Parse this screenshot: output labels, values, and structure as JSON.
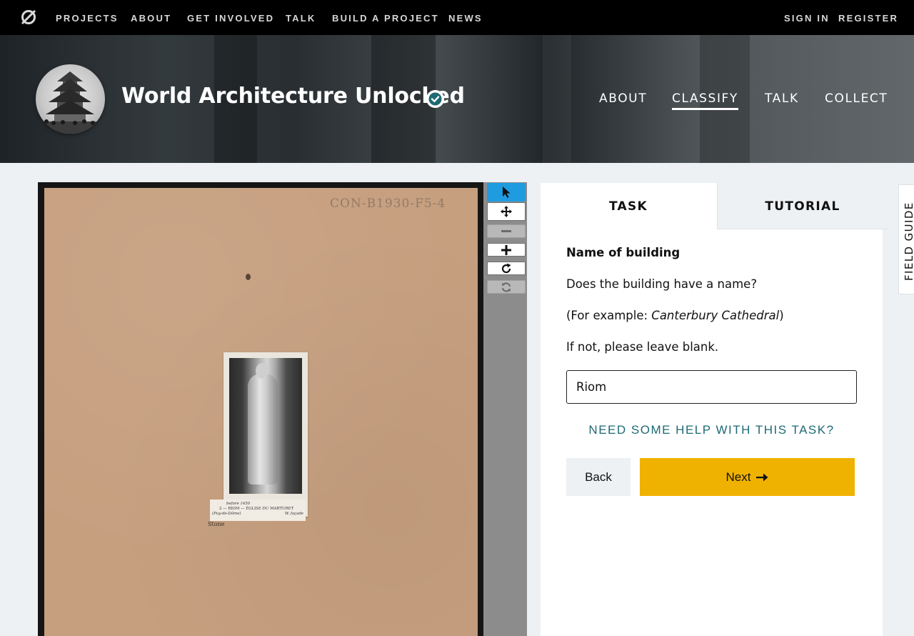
{
  "topnav": {
    "logo_icon": "zooniverse-logo-icon",
    "links": [
      "PROJECTS",
      "ABOUT",
      "GET INVOLVED",
      "TALK",
      "BUILD A PROJECT",
      "NEWS"
    ],
    "sign_in": "SIGN IN",
    "register": "REGISTER"
  },
  "project": {
    "title": "World Architecture Unlocked",
    "verified_icon": "verified-check-icon",
    "nav": [
      "ABOUT",
      "CLASSIFY",
      "TALK",
      "COLLECT"
    ],
    "active_nav": "CLASSIFY"
  },
  "subject": {
    "reference": "CON-B1930-F5-4",
    "caption_line1": "before 1450",
    "caption_line2": "2 — RIOM — ÉGLISE DU MARTURET",
    "caption_line3": "(Puy-de-Dôme)",
    "caption_line4": "W. façade",
    "scribble": "Stone"
  },
  "toolbar": {
    "tools": [
      "pointer-icon",
      "move-icon",
      "zoom-out-icon",
      "zoom-in-icon",
      "rotate-icon",
      "reset-icon"
    ]
  },
  "task_panel": {
    "tab_task": "TASK",
    "tab_tutorial": "TUTORIAL",
    "heading": "Name of building",
    "question": "Does the building have a name?",
    "example_prefix": "(For example: ",
    "example_name": "Canterbury Cathedral",
    "example_suffix": ")",
    "instruction": "If not, please leave blank.",
    "answer_value": "Riom",
    "help_link": "NEED SOME HELP WITH THIS TASK?",
    "back_label": "Back",
    "next_label": "Next",
    "next_icon": "arrow-right-icon"
  },
  "field_guide": {
    "label": "FIELD GUIDE"
  },
  "colors": {
    "accent_next": "#f0b200",
    "help_link": "#1e6a73",
    "tool_active": "#1f9be0"
  }
}
